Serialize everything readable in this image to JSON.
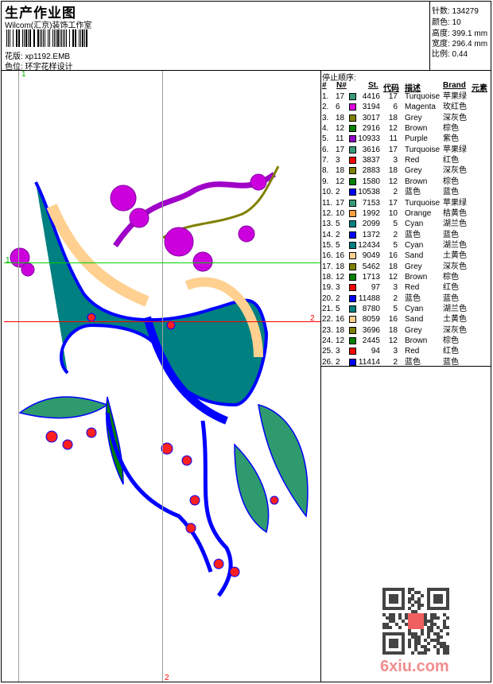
{
  "header": {
    "title": "生产作业图",
    "studio": "Wilcom(汇京)装饰工作室",
    "design_label": "花版: xp1192.EMB",
    "colorway_label": "色位: 环宇花样设计"
  },
  "stats": {
    "stitches": "针数: 134279",
    "colors": "颜色: 10",
    "height": "高度: 399.1 mm",
    "width": "宽度: 296.4 mm",
    "scale": "比例: 0.44"
  },
  "guides": {
    "v1": "1",
    "h1": "1",
    "h2": "2",
    "v2": "2"
  },
  "table": {
    "title": "停止顺序:",
    "columns": [
      "#",
      "N#",
      "St.",
      "代码",
      "描述",
      "Brand",
      "元素"
    ],
    "rows": [
      [
        "1.",
        "17",
        "#3a9a78",
        "4416",
        "17",
        "Turquoise",
        "苹果绿"
      ],
      [
        "2.",
        "6",
        "#e000e0",
        "3194",
        "6",
        "Magenta",
        "玫红色"
      ],
      [
        "3.",
        "18",
        "#808000",
        "3017",
        "18",
        "Grey",
        "深灰色"
      ],
      [
        "4.",
        "12",
        "#008000",
        "2916",
        "12",
        "Brown",
        "棕色"
      ],
      [
        "5.",
        "11",
        "#9000c8",
        "10933",
        "11",
        "Purple",
        "紫色"
      ],
      [
        "6.",
        "17",
        "#3a9a78",
        "3616",
        "17",
        "Turquoise",
        "苹果绿"
      ],
      [
        "7.",
        "3",
        "#ff0000",
        "3837",
        "3",
        "Red",
        "红色"
      ],
      [
        "8.",
        "18",
        "#808000",
        "2883",
        "18",
        "Grey",
        "深灰色"
      ],
      [
        "9.",
        "12",
        "#008000",
        "1580",
        "12",
        "Brown",
        "棕色"
      ],
      [
        "10.",
        "2",
        "#0000ff",
        "10538",
        "2",
        "蓝色",
        "蓝色"
      ],
      [
        "11.",
        "17",
        "#3a9a78",
        "7153",
        "17",
        "Turquoise",
        "苹果绿"
      ],
      [
        "12.",
        "10",
        "#ffa040",
        "1992",
        "10",
        "Orange",
        "桔黄色"
      ],
      [
        "13.",
        "5",
        "#008080",
        "2099",
        "5",
        "Cyan",
        "湖兰色"
      ],
      [
        "14.",
        "2",
        "#0000ff",
        "1372",
        "2",
        "蓝色",
        "蓝色"
      ],
      [
        "15.",
        "5",
        "#008080",
        "12434",
        "5",
        "Cyan",
        "湖兰色"
      ],
      [
        "16.",
        "16",
        "#ffd090",
        "9049",
        "16",
        "Sand",
        "土黄色"
      ],
      [
        "17.",
        "18",
        "#808000",
        "5462",
        "18",
        "Grey",
        "深灰色"
      ],
      [
        "18.",
        "12",
        "#008000",
        "1713",
        "12",
        "Brown",
        "棕色"
      ],
      [
        "19.",
        "3",
        "#ff0000",
        "97",
        "3",
        "Red",
        "红色"
      ],
      [
        "20.",
        "2",
        "#0000ff",
        "11488",
        "2",
        "蓝色",
        "蓝色"
      ],
      [
        "21.",
        "5",
        "#008080",
        "8780",
        "5",
        "Cyan",
        "湖兰色"
      ],
      [
        "22.",
        "16",
        "#ffd090",
        "8059",
        "16",
        "Sand",
        "土黄色"
      ],
      [
        "23.",
        "18",
        "#808000",
        "3696",
        "18",
        "Grey",
        "深灰色"
      ],
      [
        "24.",
        "12",
        "#008000",
        "2445",
        "12",
        "Brown",
        "棕色"
      ],
      [
        "25.",
        "3",
        "#ff0000",
        "94",
        "3",
        "Red",
        "红色"
      ],
      [
        "26.",
        "2",
        "#0000ff",
        "11414",
        "2",
        "蓝色",
        "蓝色"
      ]
    ]
  },
  "watermark": "6xiu.com"
}
